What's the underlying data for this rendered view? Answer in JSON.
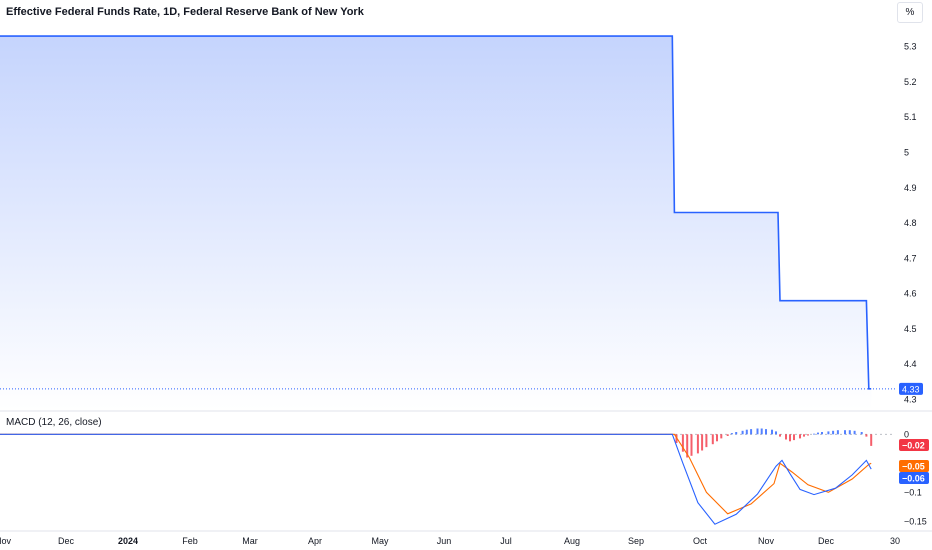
{
  "header": {
    "title": "Effective Federal Funds Rate, 1D, Federal Reserve Bank of New York",
    "unit_button": "%"
  },
  "macd": {
    "title": "MACD (12, 26, close)"
  },
  "colors": {
    "line": "#2962ff",
    "area_top": "#c5d4fd",
    "histo_pos": "#2962ff",
    "histo_neg": "#f23645",
    "macd_line": "#2962ff",
    "signal_line": "#ff6d00",
    "signal_label": "#ff6d00",
    "histo_label": "#f23645"
  },
  "chart_data": [
    {
      "type": "area",
      "title": "Effective Federal Funds Rate, 1D, Federal Reserve Bank of New York",
      "ylim": [
        4.27,
        5.37
      ],
      "y_ticks": [
        4.3,
        4.4,
        4.5,
        4.6,
        4.7,
        4.8,
        4.9,
        5,
        5.1,
        5.2,
        5.3
      ],
      "y_tick_labels": [
        "4.3",
        "4.4",
        "4.5",
        "4.6",
        "4.7",
        "4.8",
        "4.9",
        "5",
        "5.1",
        "5.2",
        "5.3"
      ],
      "x_labels": [
        "Nov",
        "Dec",
        "2024",
        "Feb",
        "Mar",
        "Apr",
        "May",
        "Jun",
        "Jul",
        "Aug",
        "Sep",
        "Oct",
        "Nov",
        "Dec",
        "30"
      ],
      "last_value_label": "4.33",
      "series": [
        {
          "points": [
            [
              "2023-10-20",
              5.33
            ],
            [
              "2024-09-18",
              5.33
            ],
            [
              "2024-09-19",
              4.83
            ],
            [
              "2024-11-07",
              4.83
            ],
            [
              "2024-11-08",
              4.58
            ],
            [
              "2024-12-18",
              4.58
            ],
            [
              "2024-12-19",
              4.33
            ],
            [
              "2024-12-20",
              4.33
            ]
          ]
        }
      ]
    },
    {
      "type": "line",
      "title": "MACD (12, 26, close)",
      "ylim": [
        -0.165,
        0.035
      ],
      "y_ticks": [
        0,
        -0.05,
        -0.1,
        -0.15
      ],
      "y_tick_labels": [
        "0",
        "−0.05",
        "−0.1",
        "−0.15"
      ],
      "value_labels": {
        "histogram": "−0.02",
        "signal": "−0.05",
        "macd": "−0.06"
      },
      "series": [
        {
          "kind": "macd",
          "points": [
            [
              "2023-10-20",
              0
            ],
            [
              "2024-09-18",
              0
            ],
            [
              "2024-09-23",
              -0.05
            ],
            [
              "2024-09-30",
              -0.118
            ],
            [
              "2024-10-08",
              -0.155
            ],
            [
              "2024-10-18",
              -0.138
            ],
            [
              "2024-10-28",
              -0.103
            ],
            [
              "2024-11-06",
              -0.055
            ],
            [
              "2024-11-09",
              -0.045
            ],
            [
              "2024-11-13",
              -0.068
            ],
            [
              "2024-11-18",
              -0.095
            ],
            [
              "2024-11-25",
              -0.104
            ],
            [
              "2024-12-05",
              -0.093
            ],
            [
              "2024-12-12",
              -0.07
            ],
            [
              "2024-12-18",
              -0.045
            ],
            [
              "2024-12-20",
              -0.06
            ]
          ]
        },
        {
          "kind": "signal",
          "points": [
            [
              "2023-10-20",
              0
            ],
            [
              "2024-09-19",
              0
            ],
            [
              "2024-09-26",
              -0.04
            ],
            [
              "2024-10-04",
              -0.1
            ],
            [
              "2024-10-14",
              -0.137
            ],
            [
              "2024-10-25",
              -0.12
            ],
            [
              "2024-11-05",
              -0.085
            ],
            [
              "2024-11-08",
              -0.05
            ],
            [
              "2024-11-14",
              -0.065
            ],
            [
              "2024-11-22",
              -0.087
            ],
            [
              "2024-12-02",
              -0.1
            ],
            [
              "2024-12-12",
              -0.077
            ],
            [
              "2024-12-19",
              -0.052
            ],
            [
              "2024-12-20",
              -0.05
            ]
          ]
        },
        {
          "kind": "histogram",
          "points": [
            [
              "2024-09-20",
              -0.015
            ],
            [
              "2024-09-23",
              -0.03
            ],
            [
              "2024-09-25",
              -0.04
            ],
            [
              "2024-09-27",
              -0.037
            ],
            [
              "2024-09-30",
              -0.033
            ],
            [
              "2024-10-02",
              -0.028
            ],
            [
              "2024-10-04",
              -0.022
            ],
            [
              "2024-10-07",
              -0.017
            ],
            [
              "2024-10-09",
              -0.012
            ],
            [
              "2024-10-11",
              -0.007
            ],
            [
              "2024-10-14",
              -0.003
            ],
            [
              "2024-10-16",
              0.002
            ],
            [
              "2024-10-18",
              0.004
            ],
            [
              "2024-10-21",
              0.006
            ],
            [
              "2024-10-23",
              0.008
            ],
            [
              "2024-10-25",
              0.009
            ],
            [
              "2024-10-28",
              0.01
            ],
            [
              "2024-10-30",
              0.01
            ],
            [
              "2024-11-01",
              0.009
            ],
            [
              "2024-11-04",
              0.008
            ],
            [
              "2024-11-06",
              0.005
            ],
            [
              "2024-11-08",
              -0.004
            ],
            [
              "2024-11-11",
              -0.009
            ],
            [
              "2024-11-13",
              -0.012
            ],
            [
              "2024-11-15",
              -0.01
            ],
            [
              "2024-11-18",
              -0.007
            ],
            [
              "2024-11-20",
              -0.004
            ],
            [
              "2024-11-22",
              -0.002
            ],
            [
              "2024-11-25",
              0.001
            ],
            [
              "2024-11-27",
              0.003
            ],
            [
              "2024-11-29",
              0.004
            ],
            [
              "2024-12-02",
              0.005
            ],
            [
              "2024-12-04",
              0.006
            ],
            [
              "2024-12-06",
              0.007
            ],
            [
              "2024-12-09",
              0.007
            ],
            [
              "2024-12-11",
              0.007
            ],
            [
              "2024-12-13",
              0.006
            ],
            [
              "2024-12-16",
              0.004
            ],
            [
              "2024-12-18",
              -0.004
            ],
            [
              "2024-12-20",
              -0.02
            ]
          ]
        }
      ]
    }
  ]
}
